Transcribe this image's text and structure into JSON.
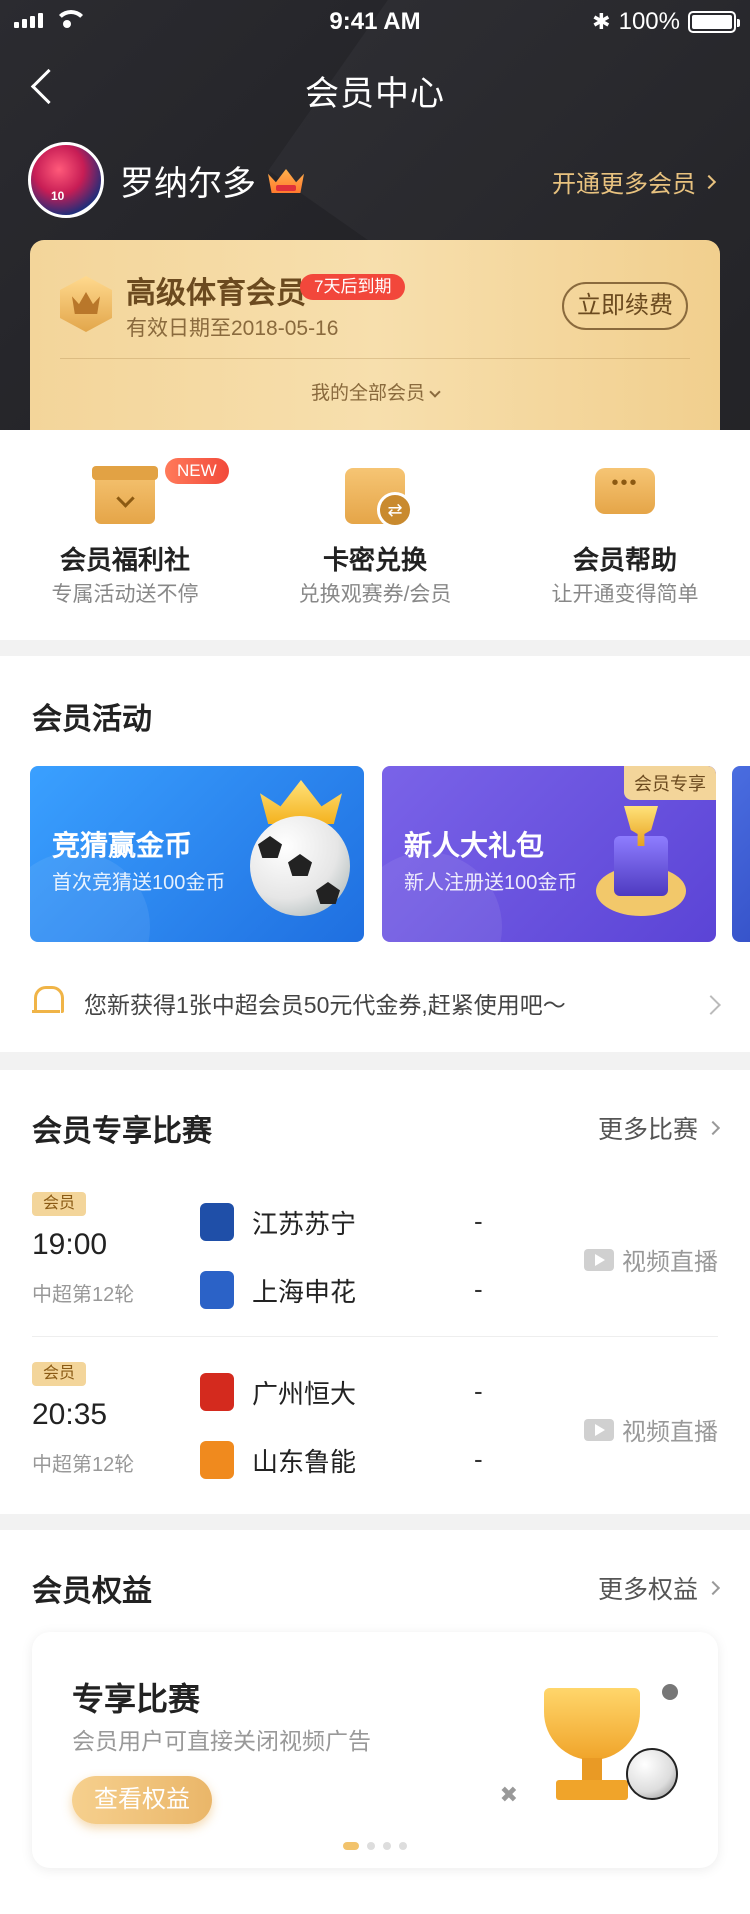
{
  "status_bar": {
    "time": "9:41 AM",
    "battery": "100%"
  },
  "nav": {
    "title": "会员中心"
  },
  "user": {
    "name": "罗纳尔多",
    "more_vip": "开通更多会员"
  },
  "vip_card": {
    "name": "高级体育会员",
    "expire_tag": "7天后到期",
    "valid_date": "有效日期至2018-05-16",
    "renew_label": "立即续费",
    "all_vip_label": "我的全部会员"
  },
  "quick_menu": [
    {
      "title": "会员福利社",
      "subtitle": "专属活动送不停",
      "badge": "NEW",
      "icon": "gift-box-icon"
    },
    {
      "title": "卡密兑换",
      "subtitle": "兑换观赛券/会员",
      "icon": "exchange-card-icon"
    },
    {
      "title": "会员帮助",
      "subtitle": "让开通变得简单",
      "icon": "chat-help-icon"
    }
  ],
  "activities": {
    "title": "会员活动",
    "items": [
      {
        "title": "竞猜赢金币",
        "subtitle": "首次竞猜送100金币"
      },
      {
        "title": "新人大礼包",
        "subtitle": "新人注册送100金币",
        "tag": "会员专享"
      }
    ],
    "notice": "您新获得1张中超会员50元代金券,赶紧使用吧～"
  },
  "matches": {
    "title": "会员专享比赛",
    "more": "更多比赛",
    "items": [
      {
        "tag": "会员",
        "time": "19:00",
        "round": "中超第12轮",
        "home": "江苏苏宁",
        "away": "上海申花",
        "home_score": "-",
        "away_score": "-",
        "live": "视频直播",
        "home_color": "#1f4fa8",
        "away_color": "#2b62c7"
      },
      {
        "tag": "会员",
        "time": "20:35",
        "round": "中超第12轮",
        "home": "广州恒大",
        "away": "山东鲁能",
        "home_score": "-",
        "away_score": "-",
        "live": "视频直播",
        "home_color": "#d42a1e",
        "away_color": "#f08a1e"
      }
    ]
  },
  "benefits": {
    "title": "会员权益",
    "more": "更多权益",
    "card": {
      "title": "专享比赛",
      "subtitle": "会员用户可直接关闭视频广告",
      "button": "查看权益"
    },
    "dots": 4,
    "active_dot": 0
  },
  "colors": {
    "gold": "#f3d59a",
    "accent_text": "#e8c27f",
    "red_tag": "#f2473b",
    "dark_header": "#1c1c20"
  }
}
